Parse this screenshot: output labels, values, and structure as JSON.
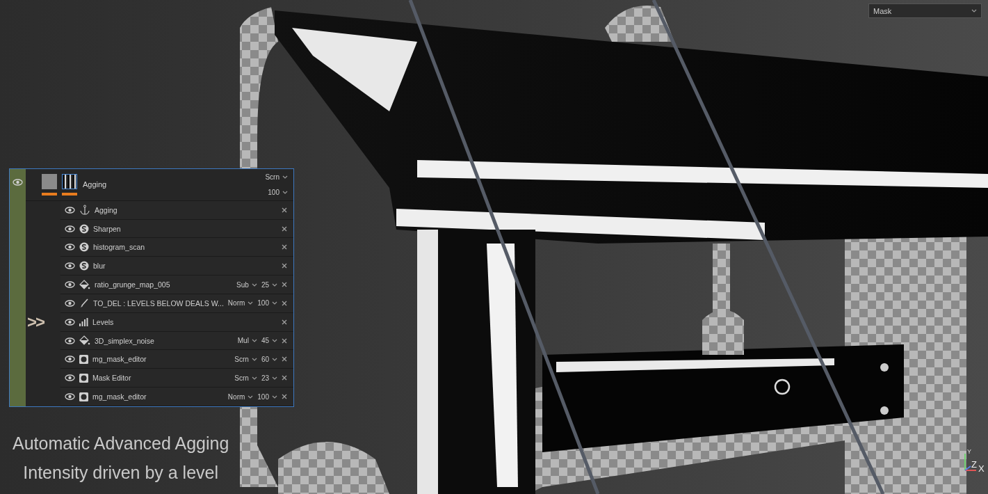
{
  "view_dropdown": {
    "value": "Mask"
  },
  "layer_panel": {
    "group": {
      "visible": true,
      "name": "Agging",
      "blend": "Scrn",
      "opacity": "100"
    },
    "marker": ">>",
    "effects": [
      {
        "kind": "anchor",
        "name": "Agging",
        "visible": true,
        "pointed": false
      },
      {
        "kind": "substance",
        "name": "Sharpen",
        "visible": true,
        "pointed": false
      },
      {
        "kind": "substance",
        "name": "histogram_scan",
        "visible": true,
        "pointed": false
      },
      {
        "kind": "substance",
        "name": "blur",
        "visible": true,
        "pointed": false
      },
      {
        "kind": "fill",
        "name": "ratio_grunge_map_005",
        "visible": true,
        "blend": "Sub",
        "opacity": "25",
        "pointed": false
      },
      {
        "kind": "paint",
        "name": "TO_DEL : LEVELS BELOW DEALS W...",
        "visible": true,
        "blend": "Norm",
        "opacity": "100",
        "pointed": false
      },
      {
        "kind": "levels",
        "name": "Levels",
        "visible": true,
        "pointed": true
      },
      {
        "kind": "fill",
        "name": "3D_simplex_noise",
        "visible": true,
        "blend": "Mul",
        "opacity": "45",
        "pointed": false
      },
      {
        "kind": "mask",
        "name": "mg_mask_editor",
        "visible": true,
        "blend": "Scrn",
        "opacity": "60",
        "pointed": false
      },
      {
        "kind": "mask",
        "name": "Mask Editor",
        "visible": true,
        "blend": "Scrn",
        "opacity": "23",
        "pointed": false
      },
      {
        "kind": "mask",
        "name": "mg_mask_editor",
        "visible": true,
        "blend": "Norm",
        "opacity": "100",
        "pointed": false
      }
    ]
  },
  "caption": [
    "Automatic Advanced Agging",
    "Intensity driven by a level"
  ],
  "axis_gizmo": {
    "y": "Y",
    "z": "Z",
    "x": "X"
  }
}
